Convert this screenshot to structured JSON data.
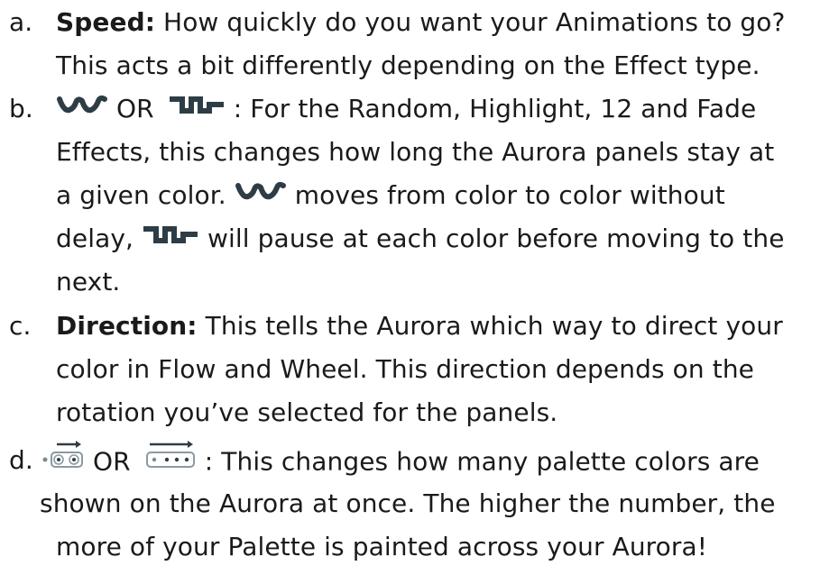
{
  "items": [
    {
      "marker": "a.",
      "term": "Speed:",
      "l1": "How quickly do you want your Animations to go?",
      "l2": "This acts a bit differently depending on the Effect type."
    },
    {
      "marker": "b.",
      "or": "OR",
      "l1": ": For the Random, Highlight, 12 and Fade",
      "l2": "Effects, this changes how long the Aurora panels stay at",
      "l3a": "a given color.",
      "l3b": "moves from color to color without",
      "l4a": "delay,",
      "l4b": "will pause at each color before moving to the",
      "l5": "next."
    },
    {
      "marker": "c.",
      "term": "Direction:",
      "l1": "This tells the Aurora which way to direct your",
      "l2": "color in Flow and Wheel. This direction depends on the",
      "l3": "rotation you’ve selected for the panels."
    },
    {
      "marker": "d.",
      "or": "OR",
      "l1": ": This changes how many palette colors are",
      "l2": "shown on the Aurora at once. The higher the number, the",
      "l3": "more of your Palette is painted across your Aurora!"
    }
  ],
  "icons": {
    "smooth": "smooth-wave-icon",
    "step": "step-wave-icon",
    "palette_small": "palette-small-group-icon",
    "palette_large": "palette-large-group-icon"
  },
  "colors": {
    "text": "#1a1a1a",
    "icon": "#2e3d45"
  }
}
